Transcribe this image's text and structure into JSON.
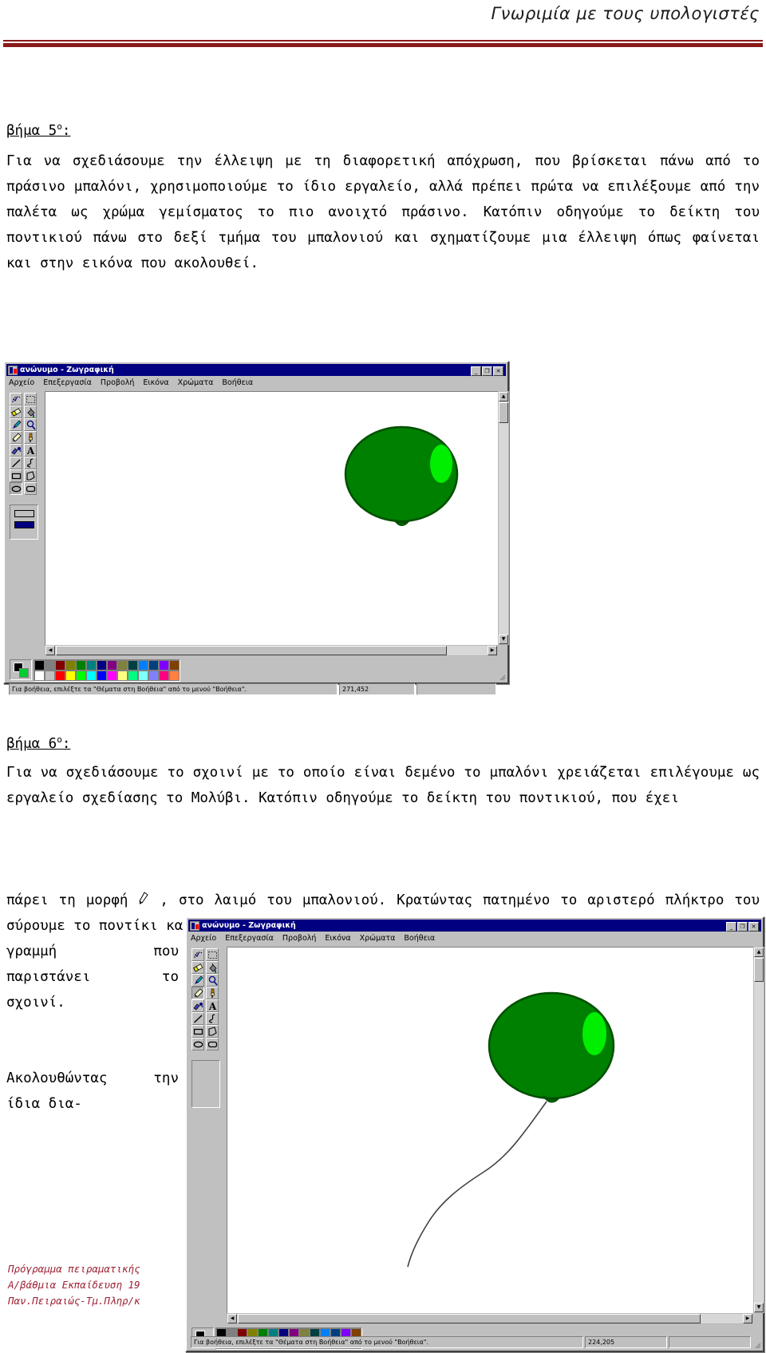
{
  "header": {
    "title": "Γνωριμία με τους υπολογιστές"
  },
  "content": {
    "step5_label": "βήμα 5",
    "step5_sup": "ο",
    "step5_colon": ":",
    "step5_text": "Για να σχεδιάσουμε την έλλειψη με τη διαφορετική απόχρωση, που βρίσκεται πάνω από το πράσινο μπαλόνι, χρησιμοποιούμε το ίδιο εργαλείο, αλλά πρέπει πρώτα να επιλέξουμε από την παλέτα ως χρώμα γεμίσματος το πιο ανοιχτό πράσινο.  Κατόπιν οδηγούμε το δείκτη του ποντικιού πάνω στο δεξί τμήμα του μπαλονιού και σχηματίζουμε μια έλλειψη όπως φαίνεται και στην εικόνα που ακολουθεί.",
    "step6_label": "βήμα 6",
    "step6_sup": "ο",
    "step6_colon": ":",
    "step6_text": "Για να σχεδιάσουμε το σχοινί με το οποίο είναι δεμένο το μπαλόνι χρειάζεται επιλέγουμε ως εργαλείο σχεδίασης το Μολύβι. Κατόπιν οδηγούμε το δείκτη του ποντικιού, που έχει",
    "step6_text_b_pre": "πάρει τη μορφή",
    "step6_text_b_post": ",   στο λαιμό του μπαλονιού. Κρατώντας πατημένο το αριστερό πλήκτρο του σύρουμε το ποντίκι και γράφουμε τη",
    "narrow_col_1": "γραμμή που παριστάνει το σχοινί.",
    "narrow_col_2": "Ακολουθώντας την ίδια δια-"
  },
  "footer": {
    "line1": "Πρόγραμμα πειραματικής",
    "line2": "Α/βάθμια Εκπαίδευση 19",
    "line3": "Παν.Πειραιώς-Τμ.Πληρ/κ"
  },
  "paint": {
    "title": "ανώνυμο - Ζωγραφική",
    "window_buttons": [
      {
        "name": "minimize",
        "glyph": "_"
      },
      {
        "name": "maximize",
        "glyph": "❐"
      },
      {
        "name": "close",
        "glyph": "✕"
      }
    ],
    "menus": [
      "Αρχείο",
      "Επεξεργασία",
      "Προβολή",
      "Εικόνα",
      "Χρώματα",
      "Βοήθεια"
    ],
    "tools": [
      "free-form-select-tool",
      "rectangular-select-tool",
      "eraser-tool",
      "fill-with-color-tool",
      "pick-color-tool",
      "magnifier-tool",
      "pencil-tool",
      "brush-tool",
      "airbrush-tool",
      "text-tool",
      "line-tool",
      "curve-tool",
      "rectangle-tool",
      "polygon-tool",
      "ellipse-tool",
      "rounded-rectangle-tool"
    ],
    "selected_tool_win1": "ellipse-tool",
    "selected_tool_win2": "pencil-tool",
    "palette_row1": [
      "#000000",
      "#808080",
      "#800000",
      "#808000",
      "#008000",
      "#008080",
      "#000080",
      "#800080",
      "#808040",
      "#004040",
      "#0080ff",
      "#004080",
      "#8000ff",
      "#804000"
    ],
    "palette_row2": [
      "#ffffff",
      "#c0c0c0",
      "#ff0000",
      "#ffff00",
      "#00ff00",
      "#00ffff",
      "#0000ff",
      "#ff00ff",
      "#ffff80",
      "#00ff80",
      "#80ffff",
      "#8080ff",
      "#ff0080",
      "#ff8040"
    ],
    "palette_fg": "#000000",
    "palette_bg": "#00cc33",
    "status_hint": "Για βοήθεια, επιλέξτε τα \"Θέματα στη Βοήθεια\" από το μενού \"Βοήθεια\".",
    "status_coords_win1": "271,452",
    "status_coords_win2": "224,205"
  },
  "drawing": {
    "balloon_body_color": "#008000",
    "balloon_highlight_color": "#00ee00",
    "balloon_outline_color": "#005000",
    "string_color": "#404040"
  }
}
